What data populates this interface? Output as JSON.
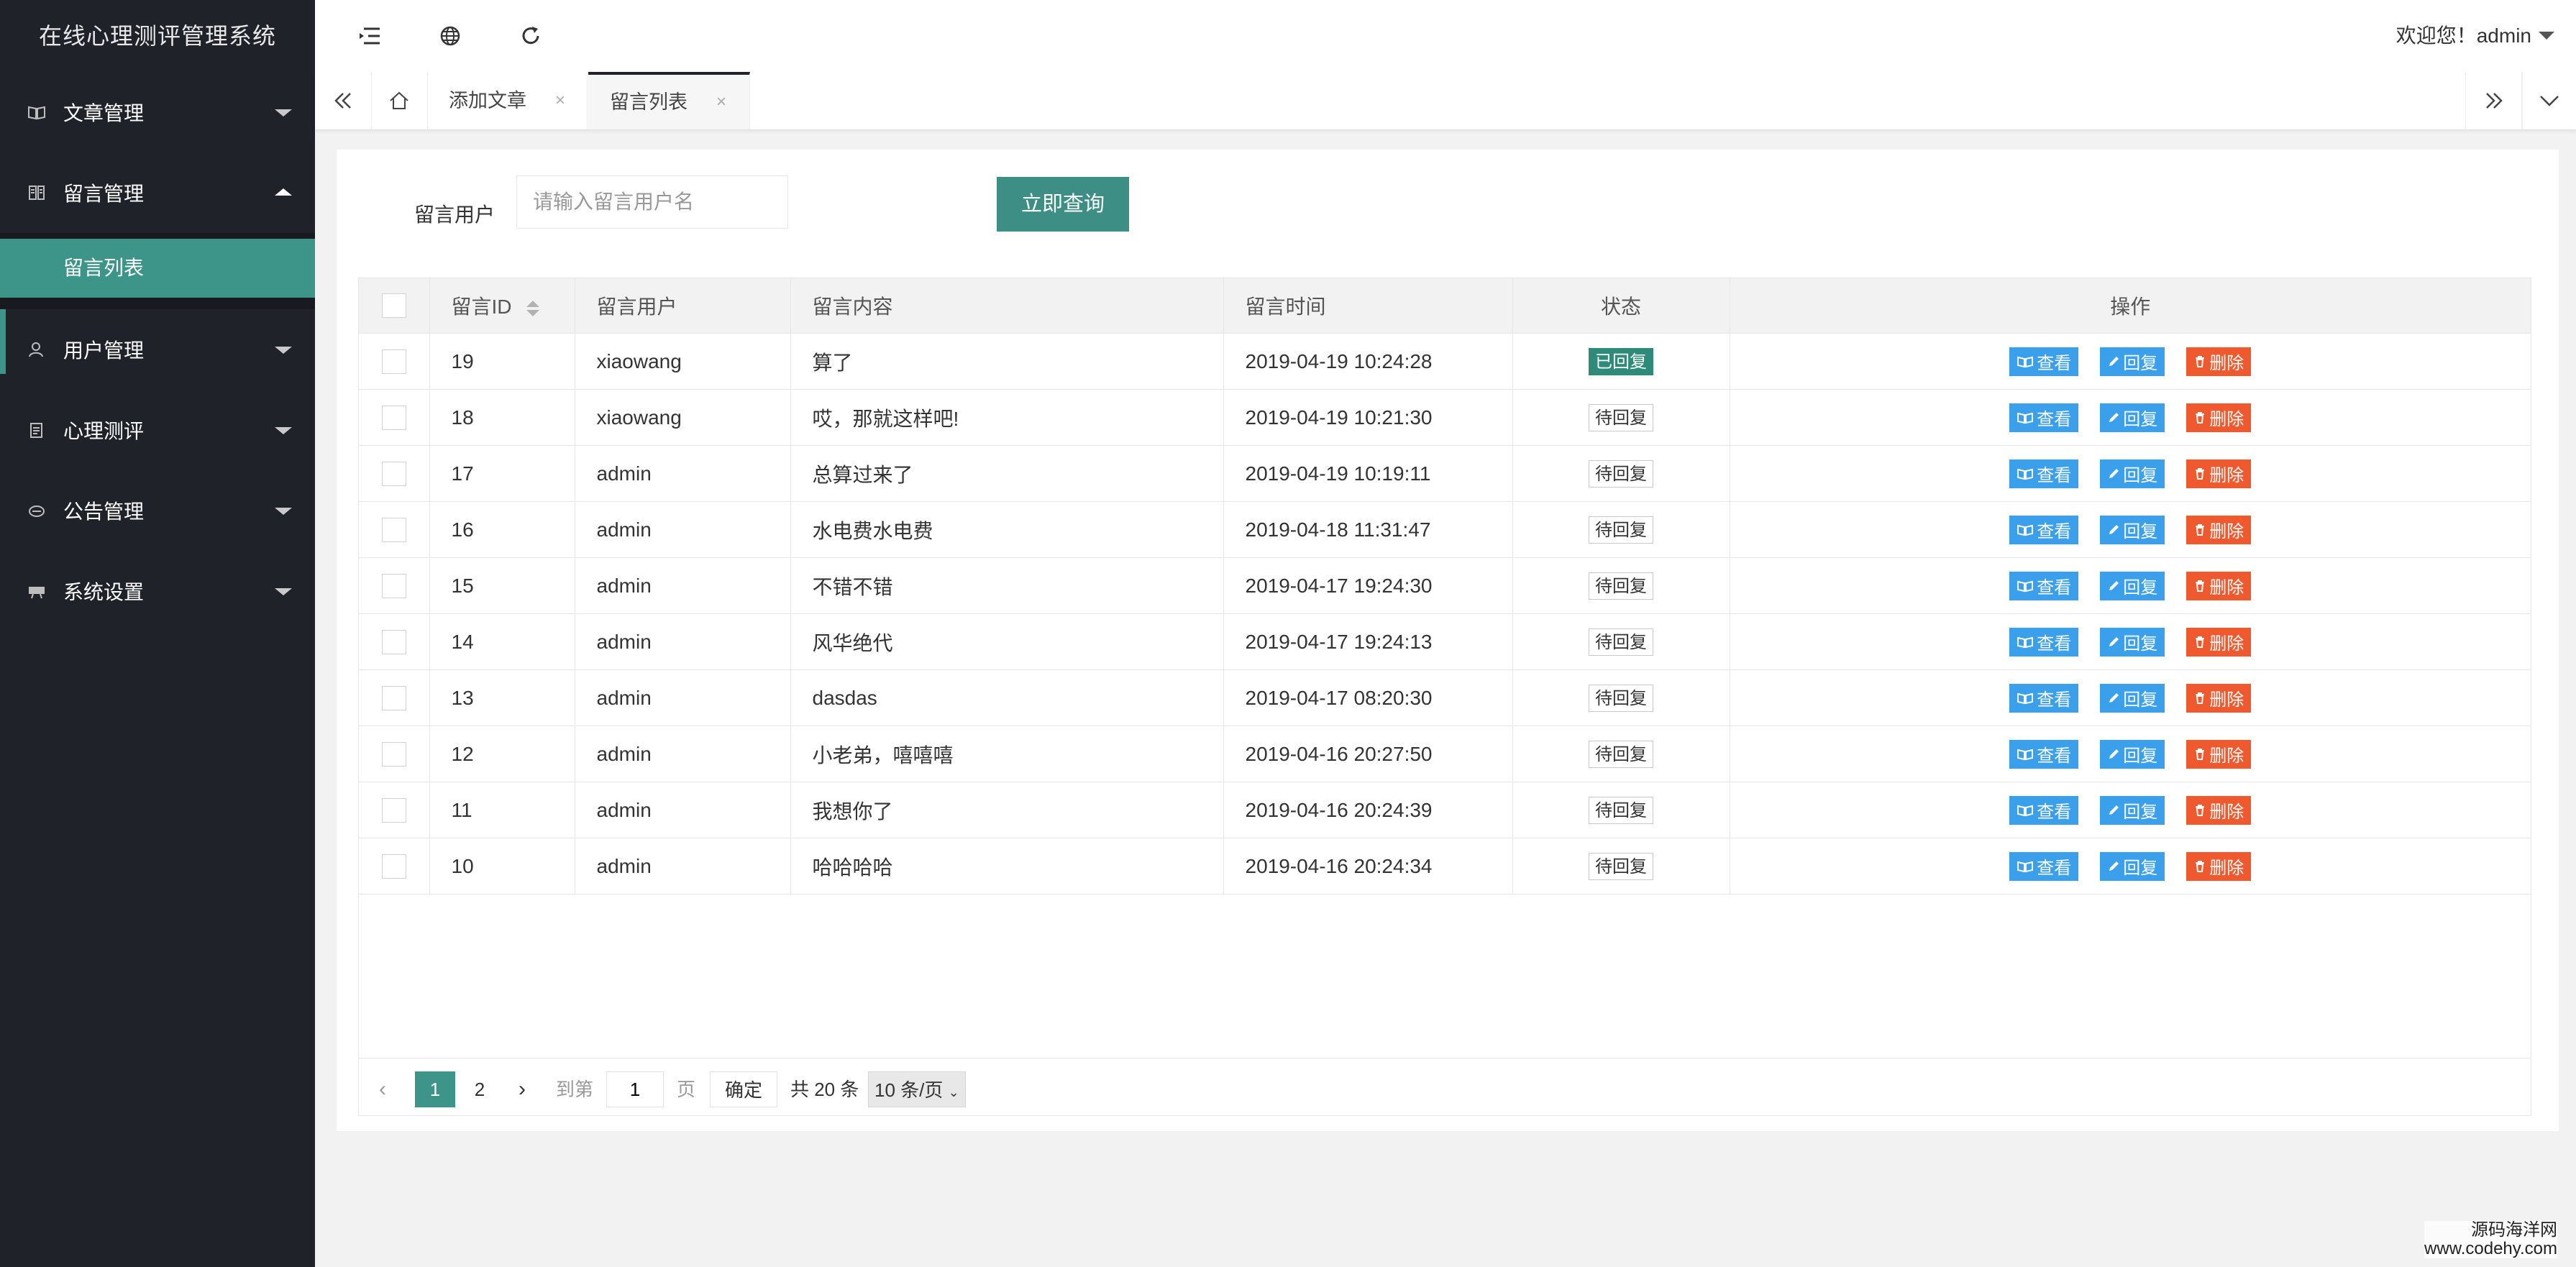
{
  "app": {
    "title": "在线心理测评管理系统"
  },
  "sidebar": {
    "items": [
      {
        "label": "文章管理",
        "icon": "book-icon",
        "expanded": false
      },
      {
        "label": "留言管理",
        "icon": "message-icon",
        "expanded": true,
        "children": [
          {
            "label": "留言列表",
            "active": true
          }
        ]
      },
      {
        "label": "用户管理",
        "icon": "user-icon",
        "expanded": false
      },
      {
        "label": "心理测评",
        "icon": "clipboard-icon",
        "expanded": false
      },
      {
        "label": "公告管理",
        "icon": "notice-icon",
        "expanded": false
      },
      {
        "label": "系统设置",
        "icon": "settings-icon",
        "expanded": false
      }
    ]
  },
  "header": {
    "icons": [
      "menu-toggle-icon",
      "globe-icon",
      "refresh-icon"
    ],
    "welcome": "欢迎您！admin"
  },
  "tabs": [
    {
      "label": "添加文章",
      "active": false
    },
    {
      "label": "留言列表",
      "active": true
    }
  ],
  "filter": {
    "label": "留言用户",
    "placeholder": "请输入留言用户名",
    "value": "",
    "button": "立即查询"
  },
  "table": {
    "columns": [
      "留言ID",
      "留言用户",
      "留言内容",
      "留言时间",
      "状态",
      "操作"
    ],
    "rows": [
      {
        "id": "19",
        "user": "xiaowang",
        "content": "算了",
        "time": "2019-04-19 10:24:28",
        "status": "已回复",
        "replied": true
      },
      {
        "id": "18",
        "user": "xiaowang",
        "content": "哎，那就这样吧!",
        "time": "2019-04-19 10:21:30",
        "status": "待回复",
        "replied": false
      },
      {
        "id": "17",
        "user": "admin",
        "content": "总算过来了",
        "time": "2019-04-19 10:19:11",
        "status": "待回复",
        "replied": false
      },
      {
        "id": "16",
        "user": "admin",
        "content": "水电费水电费",
        "time": "2019-04-18 11:31:47",
        "status": "待回复",
        "replied": false
      },
      {
        "id": "15",
        "user": "admin",
        "content": "不错不错",
        "time": "2019-04-17 19:24:30",
        "status": "待回复",
        "replied": false
      },
      {
        "id": "14",
        "user": "admin",
        "content": "风华绝代",
        "time": "2019-04-17 19:24:13",
        "status": "待回复",
        "replied": false
      },
      {
        "id": "13",
        "user": "admin",
        "content": "dasdas",
        "time": "2019-04-17 08:20:30",
        "status": "待回复",
        "replied": false
      },
      {
        "id": "12",
        "user": "admin",
        "content": "小老弟，嘻嘻嘻",
        "time": "2019-04-16 20:27:50",
        "status": "待回复",
        "replied": false
      },
      {
        "id": "11",
        "user": "admin",
        "content": "我想你了",
        "time": "2019-04-16 20:24:39",
        "status": "待回复",
        "replied": false
      },
      {
        "id": "10",
        "user": "admin",
        "content": "哈哈哈哈",
        "time": "2019-04-16 20:24:34",
        "status": "待回复",
        "replied": false
      }
    ],
    "actions": {
      "view": "查看",
      "reply": "回复",
      "delete": "删除"
    }
  },
  "pagination": {
    "pages": [
      "1",
      "2"
    ],
    "current": "1",
    "goto_label": "到第",
    "goto_value": "1",
    "page_unit": "页",
    "confirm": "确定",
    "total": "共 20 条",
    "page_size": "10 条/页"
  },
  "watermark": {
    "line1": "源码海洋网",
    "line2": "www.codehy.com"
  },
  "colors": {
    "sidebar": "#20222a",
    "accent": "#3d9488",
    "blue": "#3ba0ec",
    "danger": "#f0592e"
  }
}
